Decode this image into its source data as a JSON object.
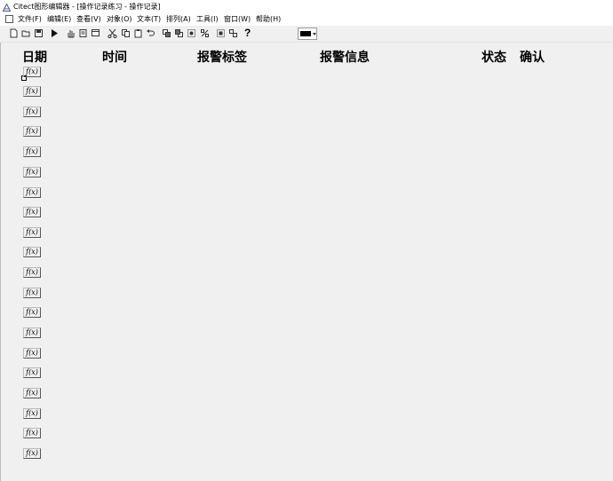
{
  "window": {
    "title": "Citect图形编辑器 - [操作记录练习 - 操作记录]"
  },
  "menu": [
    {
      "label": "文件(F)"
    },
    {
      "label": "编辑(E)"
    },
    {
      "label": "查看(V)"
    },
    {
      "label": "对象(O)"
    },
    {
      "label": "文本(T)"
    },
    {
      "label": "排列(A)"
    },
    {
      "label": "工具(I)"
    },
    {
      "label": "窗口(W)"
    },
    {
      "label": "帮助(H)"
    }
  ],
  "toolbar": {
    "help_label": "?",
    "fill_color": "#000000",
    "icons": [
      "new-file-icon",
      "open-folder-icon",
      "save-icon",
      "play-icon",
      "hand-icon",
      "page-icon",
      "window-icon",
      "cut-icon",
      "copy-icon",
      "paste-icon",
      "undo-icon",
      "bring-forward-icon",
      "send-backward-icon",
      "group-icon",
      "ungroup-icon",
      "align-icon",
      "distribute-icon",
      "help-icon"
    ]
  },
  "columns": [
    {
      "label": "日期"
    },
    {
      "label": "时间"
    },
    {
      "label": "报警标签"
    },
    {
      "label": "报警信息"
    },
    {
      "label": "状态"
    },
    {
      "label": "确认"
    }
  ],
  "cells": [
    {
      "label": "f(x)"
    },
    {
      "label": "f(x)"
    },
    {
      "label": "f(x)"
    },
    {
      "label": "f(x)"
    },
    {
      "label": "f(x)"
    },
    {
      "label": "f(x)"
    },
    {
      "label": "f(x)"
    },
    {
      "label": "f(x)"
    },
    {
      "label": "f(x)"
    },
    {
      "label": "f(x)"
    },
    {
      "label": "f(x)"
    },
    {
      "label": "f(x)"
    },
    {
      "label": "f(x)"
    },
    {
      "label": "f(x)"
    },
    {
      "label": "f(x)"
    },
    {
      "label": "f(x)"
    },
    {
      "label": "f(x)"
    },
    {
      "label": "f(x)"
    },
    {
      "label": "f(x)"
    },
    {
      "label": "f(x)"
    }
  ]
}
